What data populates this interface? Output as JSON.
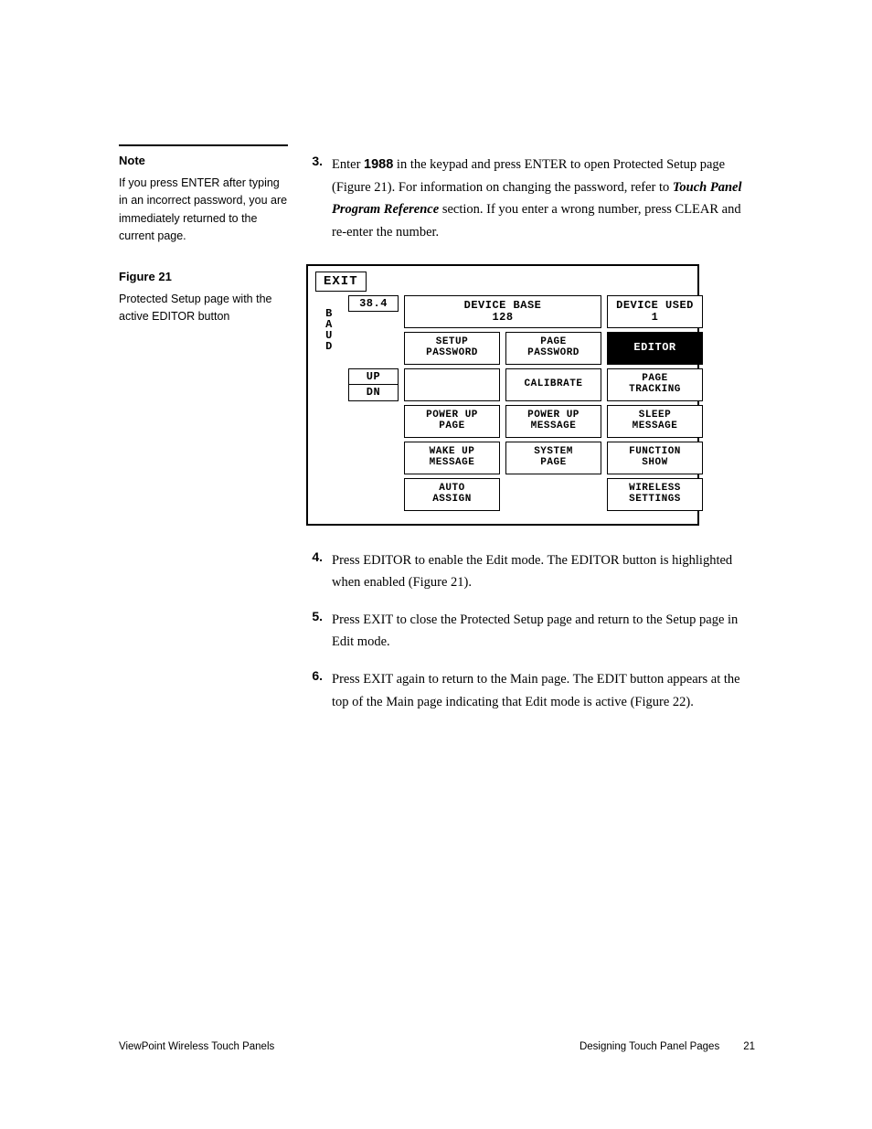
{
  "sidebar": {
    "note_heading": "Note",
    "note_body": "If you press ENTER after typing in an incorrect password, you are immediately returned to the current page.",
    "fig_heading": "Figure 21",
    "fig_caption": "Protected Setup page with the active EDITOR button"
  },
  "steps": {
    "s3_num": "3.",
    "s3_a": "Enter ",
    "s3_b": "1988",
    "s3_c": " in the keypad and press ENTER to open Protected Setup page (Figure 21). For information on changing the password, refer to ",
    "s3_d": "Touch Panel Program Reference",
    "s3_e": " section. If you enter a wrong number, press CLEAR and re-enter the number.",
    "s4_num": "4.",
    "s4": "Press EDITOR to enable the Edit mode. The EDITOR button is highlighted when enabled (Figure 21).",
    "s5_num": "5.",
    "s5": "Press EXIT to close the Protected Setup page and return to the Setup page in Edit mode.",
    "s6_num": "6.",
    "s6": "Press EXIT again to return to the Main page. The EDIT button appears at the top of the Main page indicating that Edit mode is active (Figure 22)."
  },
  "panel": {
    "exit": "EXIT",
    "baud_b": "B",
    "baud_a": "A",
    "baud_u": "U",
    "baud_d": "D",
    "rate": "38.4",
    "up": "UP",
    "dn": "DN",
    "device_base_l1": "DEVICE BASE",
    "device_base_l2": "128",
    "device_used_l1": "DEVICE USED",
    "device_used_l2": "1",
    "setup_pw_l1": "SETUP",
    "setup_pw_l2": "PASSWORD",
    "page_pw_l1": "PAGE",
    "page_pw_l2": "PASSWORD",
    "editor": "EDITOR",
    "calibrate": "CALIBRATE",
    "page_track_l1": "PAGE",
    "page_track_l2": "TRACKING",
    "powerup_page_l1": "POWER UP",
    "powerup_page_l2": "PAGE",
    "powerup_msg_l1": "POWER UP",
    "powerup_msg_l2": "MESSAGE",
    "sleep_msg_l1": "SLEEP",
    "sleep_msg_l2": "MESSAGE",
    "wakeup_msg_l1": "WAKE UP",
    "wakeup_msg_l2": "MESSAGE",
    "system_page_l1": "SYSTEM",
    "system_page_l2": "PAGE",
    "function_show_l1": "FUNCTION",
    "function_show_l2": "SHOW",
    "auto_assign_l1": "AUTO",
    "auto_assign_l2": "ASSIGN",
    "wireless_l1": "WIRELESS",
    "wireless_l2": "SETTINGS"
  },
  "footer": {
    "left": "ViewPoint Wireless Touch Panels",
    "section": "Designing Touch Panel Pages",
    "page": "21"
  }
}
